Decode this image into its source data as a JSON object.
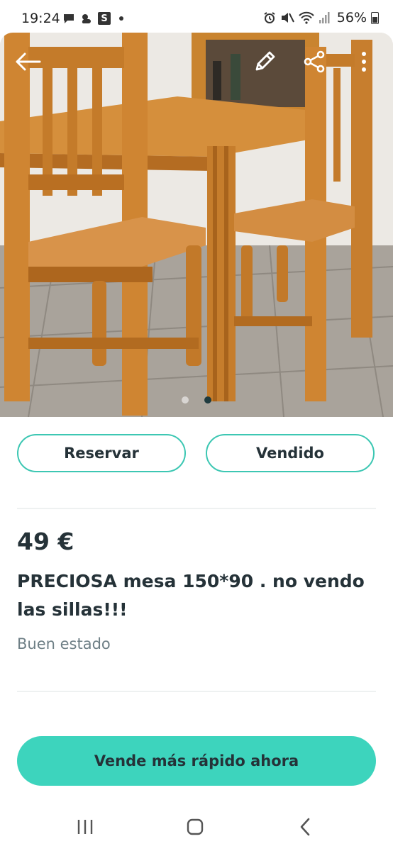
{
  "status_bar": {
    "time": "19:24",
    "badge": "S",
    "battery": "56%",
    "left_icons": [
      "chat-icon",
      "weather-icon",
      "s-app-icon",
      "notification-dot"
    ],
    "right_icons": [
      "alarm-icon",
      "mute-icon",
      "wifi-icon",
      "signal-icon",
      "battery-icon"
    ]
  },
  "gallery": {
    "image_count": 2,
    "active_index": 1,
    "top_actions": [
      "back-arrow-icon",
      "edit-pencil-icon",
      "share-icon",
      "more-vertical-icon"
    ]
  },
  "actions": {
    "reserve_label": "Reservar",
    "sold_label": "Vendido"
  },
  "listing": {
    "price": "49 €",
    "title": "PRECIOSA mesa  150*90 . no vendo las sillas!!!",
    "condition": "Buen estado"
  },
  "promote": {
    "label": "Vende más rápido ahora"
  },
  "colors": {
    "accent": "#3dd4bd",
    "accent_border": "#3dc7b3",
    "text": "#253238",
    "muted": "#6e7f86"
  },
  "nav_bar": [
    "recent-apps-icon",
    "home-icon",
    "back-icon"
  ]
}
